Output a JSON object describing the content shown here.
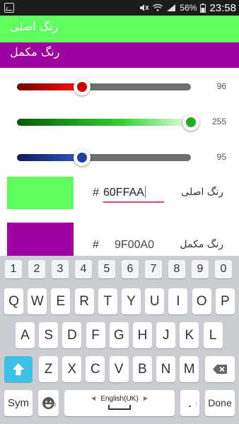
{
  "status_bar": {
    "battery": "56%",
    "time": "23:58"
  },
  "header": {
    "primary_label": "رنگ اصلی",
    "complement_label": "رنگ مکمل"
  },
  "colors": {
    "primary": "#60ff60",
    "complement": "#9f00a0",
    "red_slider": "#cc0000",
    "green_slider": "#22aa22",
    "blue_slider": "#2040a0",
    "accent": "#e5456e"
  },
  "sliders": [
    {
      "name": "red",
      "value": "96",
      "level": 0.376
    },
    {
      "name": "green",
      "value": "255",
      "level": 1.0
    },
    {
      "name": "blue",
      "value": "95",
      "level": 0.373
    }
  ],
  "primary_row": {
    "hash": "#",
    "hex": "60FFAA",
    "label": "رنگ اصلی"
  },
  "complement_row": {
    "hash": "#",
    "hex": "9F00A0",
    "label": "رنگ مکمل"
  },
  "keyboard": {
    "numbers": [
      "1",
      "2",
      "3",
      "4",
      "5",
      "6",
      "7",
      "8",
      "9",
      "0"
    ],
    "row1": [
      "Q",
      "W",
      "E",
      "R",
      "T",
      "Y",
      "U",
      "I",
      "O",
      "P"
    ],
    "row2": [
      "A",
      "S",
      "D",
      "F",
      "G",
      "H",
      "J",
      "K",
      "L"
    ],
    "row3": [
      "Z",
      "X",
      "C",
      "V",
      "B",
      "N",
      "M"
    ],
    "sym": "Sym",
    "language": "English(UK)",
    "done": "Done"
  }
}
